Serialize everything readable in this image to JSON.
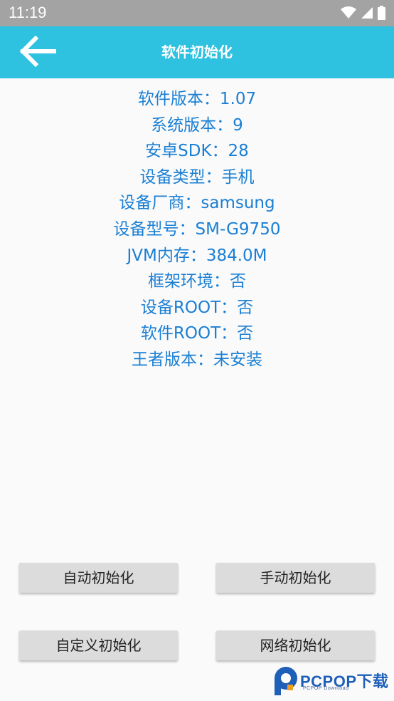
{
  "status_bar": {
    "time": "11:19",
    "icons": [
      "wifi-icon",
      "signal-icon",
      "battery-icon"
    ]
  },
  "app_bar": {
    "title": "软件初始化",
    "back_icon": "arrow-left-icon",
    "color": "#2ec1e0"
  },
  "info": [
    "软件版本：1.07",
    "系统版本：9",
    "安卓SDK：28",
    "设备类型：手机",
    "设备厂商：samsung",
    "设备型号：SM-G9750",
    "JVM内存：384.0M",
    "框架环境：否",
    "设备ROOT：否",
    "软件ROOT：否",
    "王者版本：未安装"
  ],
  "info_color": "#1a7fd4",
  "buttons": {
    "auto_init": "自动初始化",
    "manual_init": "手动初始化",
    "custom_init": "自定义初始化",
    "network_init": "网络初始化"
  },
  "watermark": {
    "brand": "PCPOP下载",
    "sub": "PCPOP Download"
  }
}
